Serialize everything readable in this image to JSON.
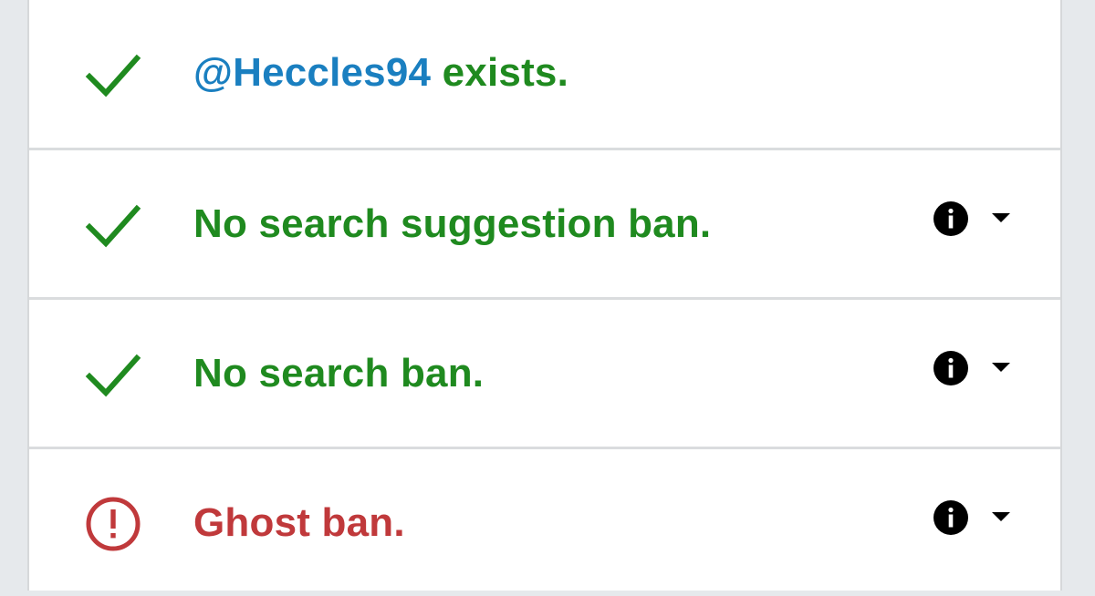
{
  "rows": [
    {
      "status": "ok",
      "icon": "checkmark-icon",
      "handle": "@Heccles94",
      "text": " exists.",
      "has_details": false
    },
    {
      "status": "ok",
      "icon": "checkmark-icon",
      "text": "No search suggestion ban.",
      "has_details": true
    },
    {
      "status": "ok",
      "icon": "checkmark-icon",
      "text": "No search ban.",
      "has_details": true
    },
    {
      "status": "ban",
      "icon": "exclamation-circle-icon",
      "text": "Ghost ban.",
      "has_details": true
    }
  ],
  "colors": {
    "ok": "#1f8a1f",
    "ban": "#c0393b",
    "handle": "#1a7fc0"
  },
  "detail_icons": [
    "info-icon",
    "caret-down-icon"
  ]
}
